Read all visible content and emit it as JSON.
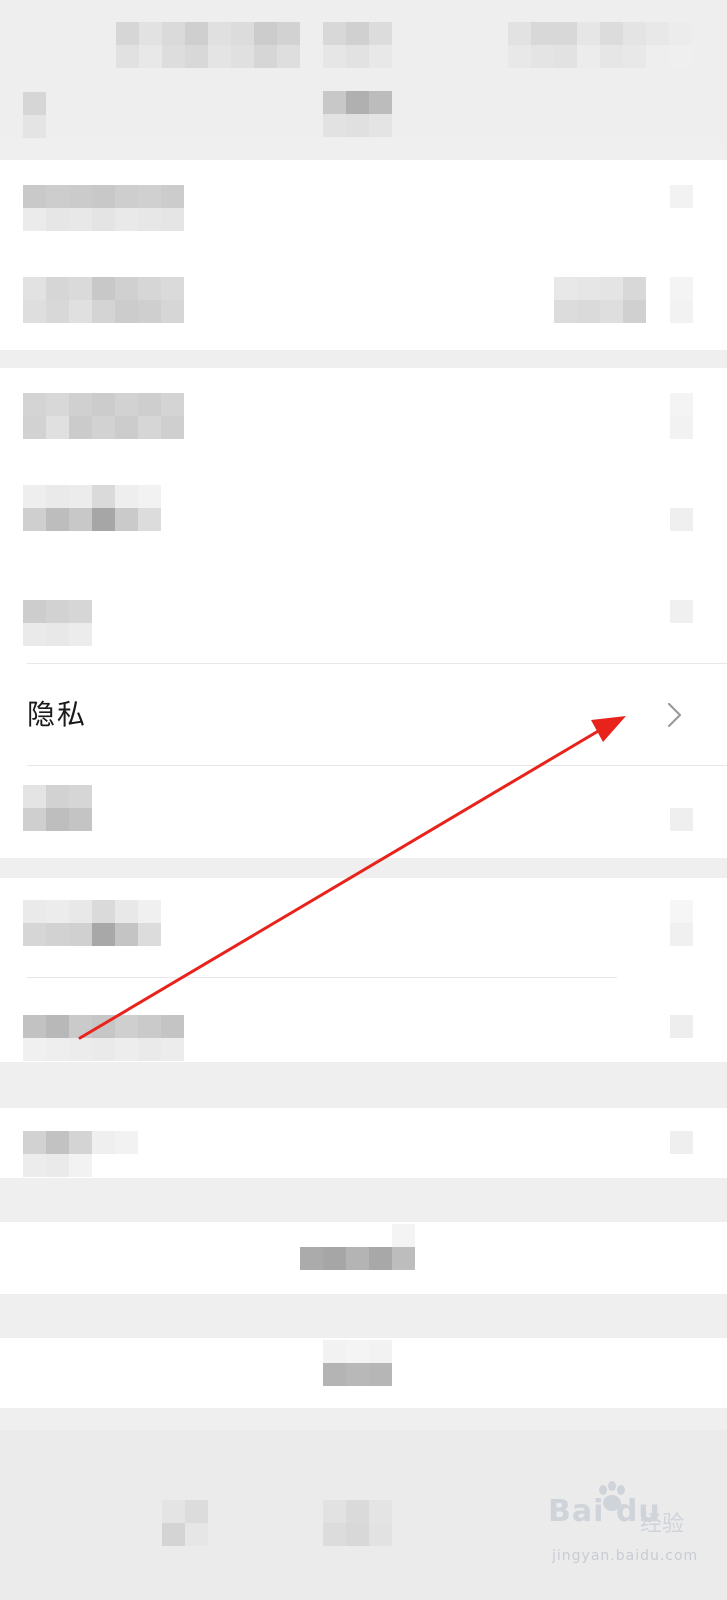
{
  "settings": {
    "privacy_label": "隐私",
    "chevron_icon": "chevron-right-icon"
  },
  "annotation": {
    "arrow_color": "#e8231c",
    "arrow_icon": "red-arrow-pointer-icon"
  },
  "watermark": {
    "logo_text": "Bai du",
    "cn_text": "经验",
    "url_text": "jingyan.baidu.com",
    "logo_icon": "baidu-paw-icon"
  }
}
